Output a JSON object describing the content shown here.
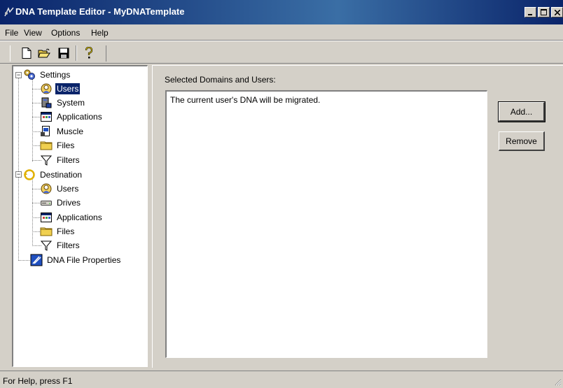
{
  "window": {
    "title": "DNA Template Editor - MyDNATemplate",
    "controls": [
      "_",
      "□",
      "×"
    ]
  },
  "menubar": {
    "items": [
      "File",
      "View",
      "Options",
      "Help"
    ]
  },
  "toolbar": {
    "buttons": [
      "new-icon",
      "open-icon",
      "save-icon",
      "help-icon"
    ]
  },
  "tree": {
    "nodes": [
      {
        "label": "Settings",
        "icon": "settings-gear-icon",
        "level": 0,
        "expander": "−"
      },
      {
        "label": "Users",
        "icon": "users-icon",
        "level": 1,
        "selected": true
      },
      {
        "label": "System",
        "icon": "system-icon",
        "level": 1
      },
      {
        "label": "Applications",
        "icon": "applications-icon",
        "level": 1
      },
      {
        "label": "Muscle",
        "icon": "muscle-icon",
        "level": 1
      },
      {
        "label": "Files",
        "icon": "folder-icon",
        "level": 1
      },
      {
        "label": "Filters",
        "icon": "filter-icon",
        "level": 1
      },
      {
        "label": "Destination",
        "icon": "destination-icon",
        "level": 0,
        "expander": "−"
      },
      {
        "label": "Users",
        "icon": "users-icon",
        "level": 1
      },
      {
        "label": "Drives",
        "icon": "drive-icon",
        "level": 1
      },
      {
        "label": "Applications",
        "icon": "applications-icon",
        "level": 1
      },
      {
        "label": "Files",
        "icon": "folder-icon",
        "level": 1
      },
      {
        "label": "Filters",
        "icon": "filter-icon",
        "level": 1
      },
      {
        "label": "DNA File Properties",
        "icon": "dna-file-properties-icon",
        "level": 0
      }
    ]
  },
  "main": {
    "section_label": "Selected Domains and Users:",
    "list_items": [
      "The current user's DNA will be migrated."
    ],
    "add_button": "Add...",
    "remove_button": "Remove"
  },
  "statusbar": {
    "text": "For Help, press F1"
  }
}
